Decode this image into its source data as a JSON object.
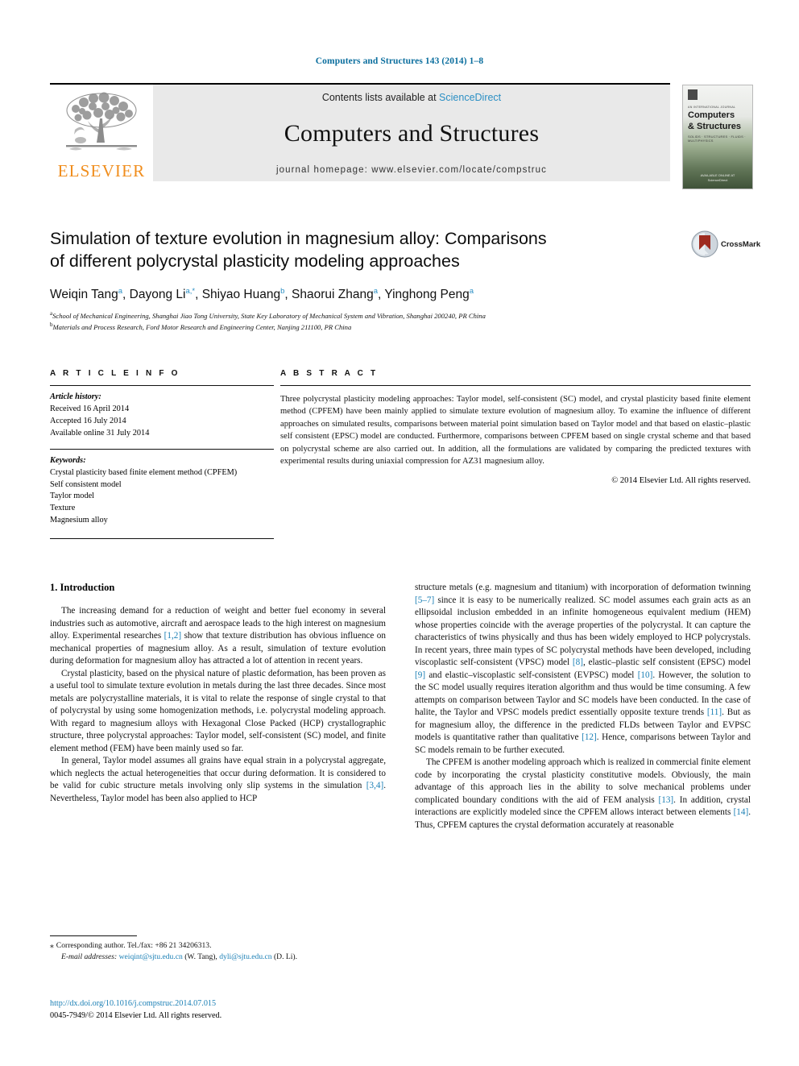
{
  "running_head": "Computers and Structures 143 (2014) 1–8",
  "masthead": {
    "publisher": "ELSEVIER",
    "contents_prefix": "Contents lists available at ",
    "contents_link": "ScienceDirect",
    "journal_title": "Computers and Structures",
    "homepage": "journal homepage: www.elsevier.com/locate/compstruc"
  },
  "cover": {
    "subtitle": "AN INTERNATIONAL JOURNAL",
    "line1": "Computers",
    "line2": "& Structures",
    "rule": "SOLIDS · STRUCTURES · FLUIDS · MULTIPHYSICS",
    "foot1": "AVAILABLE ONLINE AT",
    "foot2": "ScienceDirect"
  },
  "crossmark": {
    "label": "CrossMark"
  },
  "article": {
    "title_line1": "Simulation of texture evolution in magnesium alloy: Comparisons",
    "title_line2": "of different polycrystal plasticity modeling approaches",
    "authors": "Weiqin Tang a, Dayong Li a,*, Shiyao Huang b, Shaorui Zhang a, Yinghong Peng a",
    "affiliation_a": "School of Mechanical Engineering, Shanghai Jiao Tong University, State Key Laboratory of Mechanical System and Vibration, Shanghai 200240, PR China",
    "affiliation_b": "Materials and Process Research, Ford Motor Research and Engineering Center, Nanjing 211100, PR China"
  },
  "info": {
    "heading": "A R T I C L E   I N F O",
    "history_label": "Article history:",
    "history": [
      "Received 16 April 2014",
      "Accepted 16 July 2014",
      "Available online 31 July 2014"
    ],
    "keywords_label": "Keywords:",
    "keywords": [
      "Crystal plasticity based finite element method (CPFEM)",
      "Self consistent model",
      "Taylor model",
      "Texture",
      "Magnesium alloy"
    ]
  },
  "abstract": {
    "heading": "A B S T R A C T",
    "body": "Three polycrystal plasticity modeling approaches: Taylor model, self-consistent (SC) model, and crystal plasticity based finite element method (CPFEM) have been mainly applied to simulate texture evolution of magnesium alloy. To examine the influence of different approaches on simulated results, comparisons between material point simulation based on Taylor model and that based on elastic–plastic self consistent (EPSC) model are conducted. Furthermore, comparisons between CPFEM based on single crystal scheme and that based on polycrystal scheme are also carried out. In addition, all the formulations are validated by comparing the predicted textures with experimental results during uniaxial compression for AZ31 magnesium alloy.",
    "copyright": "© 2014 Elsevier Ltd. All rights reserved."
  },
  "intro": {
    "section_title": "1. Introduction",
    "left_paragraphs": [
      "The increasing demand for a reduction of weight and better fuel economy in several industries such as automotive, aircraft and aerospace leads to the high interest on magnesium alloy. Experimental researches [1,2] show that texture distribution has obvious influence on mechanical properties of magnesium alloy. As a result, simulation of texture evolution during deformation for magnesium alloy has attracted a lot of attention in recent years.",
      "Crystal plasticity, based on the physical nature of plastic deformation, has been proven as a useful tool to simulate texture evolution in metals during the last three decades. Since most metals are polycrystalline materials, it is vital to relate the response of single crystal to that of polycrystal by using some homogenization methods, i.e. polycrystal modeling approach. With regard to magnesium alloys with Hexagonal Close Packed (HCP) crystallographic structure, three polycrystal approaches: Taylor model, self-consistent (SC) model, and finite element method (FEM) have been mainly used so far.",
      "In general, Taylor model assumes all grains have equal strain in a polycrystal aggregate, which neglects the actual heterogeneities that occur during deformation. It is considered to be valid for cubic structure metals involving only slip systems in the simulation [3,4]. Nevertheless, Taylor model has been also applied to HCP"
    ],
    "right_paragraphs": [
      "structure metals (e.g. magnesium and titanium) with incorporation of deformation twinning [5–7] since it is easy to be numerically realized. SC model assumes each grain acts as an ellipsoidal inclusion embedded in an infinite homogeneous equivalent medium (HEM) whose properties coincide with the average properties of the polycrystal. It can capture the characteristics of twins physically and thus has been widely employed to HCP polycrystals. In recent years, three main types of SC polycrystal methods have been developed, including viscoplastic self-consistent (VPSC) model [8], elastic–plastic self consistent (EPSC) model [9] and elastic–viscoplastic self-consistent (EVPSC) model [10]. However, the solution to the SC model usually requires iteration algorithm and thus would be time consuming. A few attempts on comparison between Taylor and SC models have been conducted. In the case of halite, the Taylor and VPSC models predict essentially opposite texture trends [11]. But as for magnesium alloy, the difference in the predicted FLDs between Taylor and EVPSC models is quantitative rather than qualitative [12]. Hence, comparisons between Taylor and SC models remain to be further executed.",
      "The CPFEM is another modeling approach which is realized in commercial finite element code by incorporating the crystal plasticity constitutive models. Obviously, the main advantage of this approach lies in the ability to solve mechanical problems under complicated boundary conditions with the aid of FEM analysis [13]. In addition, crystal interactions are explicitly modeled since the CPFEM allows interact between elements [14]. Thus, CPFEM captures the crystal deformation accurately at reasonable"
    ]
  },
  "footnote": {
    "corresponding": "Corresponding author. Tel./fax: +86 21 34206313.",
    "email_label": "E-mail addresses:",
    "email1": "weiqint@sjtu.edu.cn",
    "email1_owner": "(W. Tang),",
    "email2": "dyli@sjtu.edu.cn",
    "email2_owner": "(D. Li)."
  },
  "imprint": {
    "doi": "http://dx.doi.org/10.1016/j.compstruc.2014.07.015",
    "issn": "0045-7949/© 2014 Elsevier Ltd. All rights reserved."
  },
  "colors": {
    "link": "#1a7fb5",
    "running_head": "#0b6e9e",
    "elsevier_orange": "#f08d1c",
    "band_gray": "#e9e9e9"
  }
}
